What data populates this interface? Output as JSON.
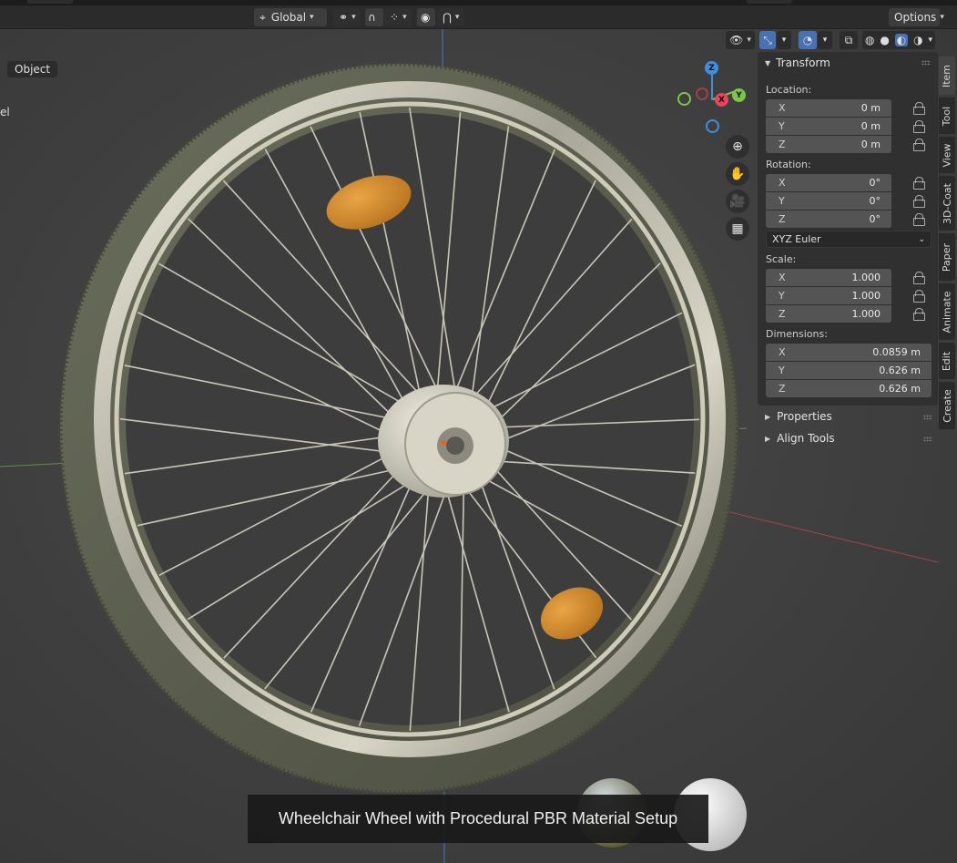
{
  "header": {
    "orientation_label": "Global",
    "options_label": "Options"
  },
  "viewport": {
    "mode_label": "Object",
    "left_fragment": "el",
    "caption": "Wheelchair Wheel with Procedural PBR Material Setup",
    "gizmo": {
      "z": "Z",
      "y": "Y",
      "x": "X"
    }
  },
  "npanel": {
    "transform_title": "Transform",
    "location_label": "Location:",
    "location": [
      {
        "axis": "X",
        "value": "0 m"
      },
      {
        "axis": "Y",
        "value": "0 m"
      },
      {
        "axis": "Z",
        "value": "0 m"
      }
    ],
    "rotation_label": "Rotation:",
    "rotation": [
      {
        "axis": "X",
        "value": "0°"
      },
      {
        "axis": "Y",
        "value": "0°"
      },
      {
        "axis": "Z",
        "value": "0°"
      }
    ],
    "rotation_mode": "XYZ Euler",
    "scale_label": "Scale:",
    "scale": [
      {
        "axis": "X",
        "value": "1.000"
      },
      {
        "axis": "Y",
        "value": "1.000"
      },
      {
        "axis": "Z",
        "value": "1.000"
      }
    ],
    "dimensions_label": "Dimensions:",
    "dimensions": [
      {
        "axis": "X",
        "value": "0.0859 m"
      },
      {
        "axis": "Y",
        "value": "0.626 m"
      },
      {
        "axis": "Z",
        "value": "0.626 m"
      }
    ],
    "properties_title": "Properties",
    "align_tools_title": "Align Tools"
  },
  "tabs": [
    "Item",
    "Tool",
    "View",
    "3D-Coat",
    "Paper",
    "Animate",
    "Edit",
    "Create"
  ],
  "colors": {
    "accent": "#4772b3",
    "axis_x": "#e8455a",
    "axis_y": "#7fc44b",
    "axis_z": "#3f8ee0"
  }
}
